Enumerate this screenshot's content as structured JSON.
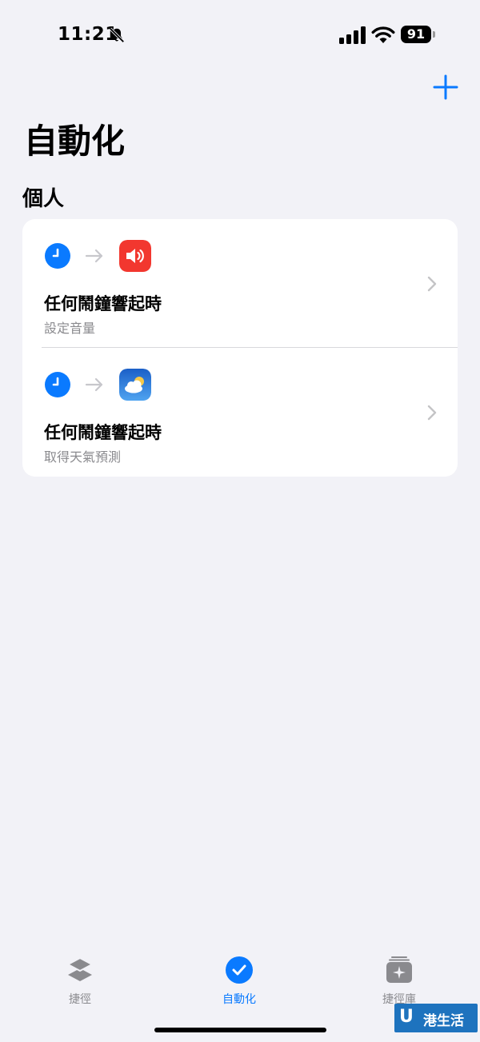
{
  "status_bar": {
    "time": "11:21",
    "battery": "91"
  },
  "header": {
    "title": "自動化"
  },
  "section": {
    "title": "個人"
  },
  "automations": [
    {
      "title": "任何鬧鐘響起時",
      "subtitle": "設定音量",
      "trigger_icon": "clock-icon",
      "action_icon": "volume-icon"
    },
    {
      "title": "任何鬧鐘響起時",
      "subtitle": "取得天氣預測",
      "trigger_icon": "clock-icon",
      "action_icon": "weather-icon"
    }
  ],
  "tabs": [
    {
      "label": "捷徑",
      "icon": "layers-icon",
      "active": false
    },
    {
      "label": "自動化",
      "icon": "checkmark-clock-icon",
      "active": true
    },
    {
      "label": "捷徑庫",
      "icon": "gallery-icon",
      "active": false
    }
  ],
  "watermark": {
    "logo": "U",
    "text": "港生活"
  },
  "colors": {
    "accent": "#0A7AFF",
    "background": "#F2F2F7",
    "volume_red": "#F2372F",
    "weather_blue": "#2B7FE0"
  }
}
